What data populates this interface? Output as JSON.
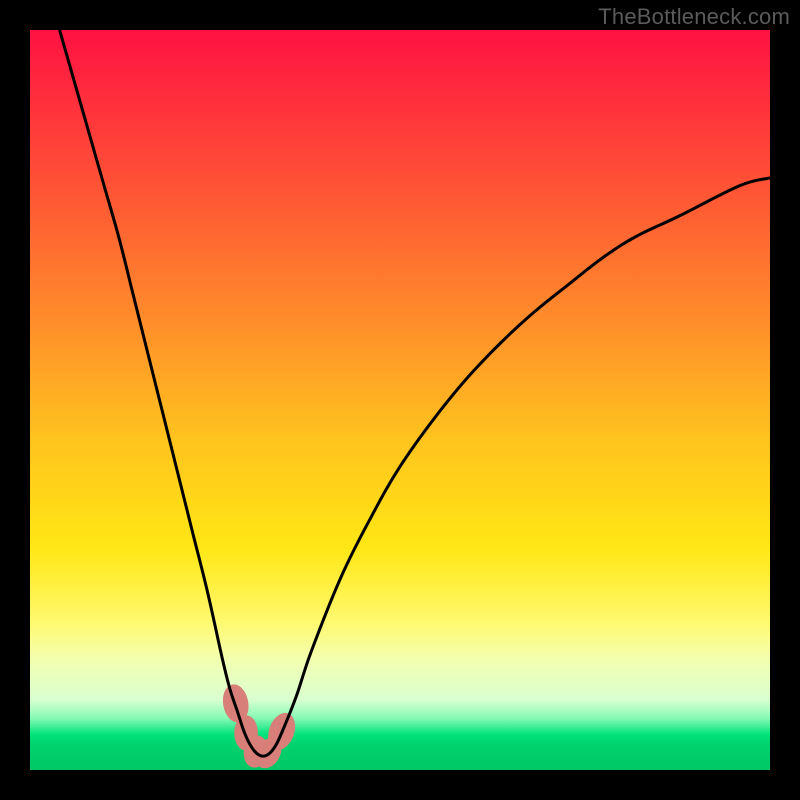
{
  "attribution": "TheBottleneck.com",
  "colors": {
    "frame": "#000000",
    "attribution_text": "#5b5b5b",
    "curve_stroke": "#000000",
    "marker_fill": "#d77f78",
    "marker_stroke": "#d77f78",
    "gradient_stops": [
      {
        "offset": 0.0,
        "color": "#ff1242"
      },
      {
        "offset": 0.2,
        "color": "#ff4f36"
      },
      {
        "offset": 0.4,
        "color": "#ff8f2a"
      },
      {
        "offset": 0.55,
        "color": "#ffc21e"
      },
      {
        "offset": 0.7,
        "color": "#ffe714"
      },
      {
        "offset": 0.8,
        "color": "#fff96f"
      },
      {
        "offset": 0.85,
        "color": "#f3ffb0"
      },
      {
        "offset": 0.905,
        "color": "#d9ffd0"
      },
      {
        "offset": 0.93,
        "color": "#86f9b5"
      },
      {
        "offset": 0.952,
        "color": "#00e37a"
      },
      {
        "offset": 0.965,
        "color": "#00d36f"
      },
      {
        "offset": 1.0,
        "color": "#00c765"
      }
    ]
  },
  "chart_data": {
    "type": "line",
    "title": "",
    "xlabel": "",
    "ylabel": "",
    "xlim": [
      0,
      100
    ],
    "ylim": [
      0,
      100
    ],
    "grid": false,
    "legend": false,
    "series": [
      {
        "name": "bottleneck-curve",
        "x": [
          4,
          6,
          8,
          10,
          12,
          14,
          16,
          18,
          20,
          22,
          24,
          26,
          27,
          28,
          29,
          30,
          31,
          32,
          33,
          34,
          36,
          38,
          42,
          46,
          50,
          55,
          60,
          66,
          72,
          80,
          88,
          96,
          100
        ],
        "y": [
          100,
          93,
          86,
          79,
          72,
          64,
          56,
          48,
          40,
          32,
          24,
          15,
          11,
          8,
          5,
          3,
          2,
          2,
          3,
          5,
          10,
          16,
          26,
          34,
          41,
          48,
          54,
          60,
          65,
          71,
          75,
          79,
          80
        ]
      }
    ],
    "markers": [
      {
        "x": 27.8,
        "y": 9,
        "rx": 1.7,
        "ry": 2.6,
        "rot": -10
      },
      {
        "x": 29.2,
        "y": 5,
        "rx": 1.6,
        "ry": 2.4,
        "rot": 0
      },
      {
        "x": 30.5,
        "y": 2.5,
        "rx": 1.6,
        "ry": 2.2,
        "rot": 10
      },
      {
        "x": 32.2,
        "y": 2.3,
        "rx": 1.6,
        "ry": 2.2,
        "rot": 30
      },
      {
        "x": 34.0,
        "y": 5.2,
        "rx": 1.7,
        "ry": 2.6,
        "rot": 20
      }
    ]
  }
}
